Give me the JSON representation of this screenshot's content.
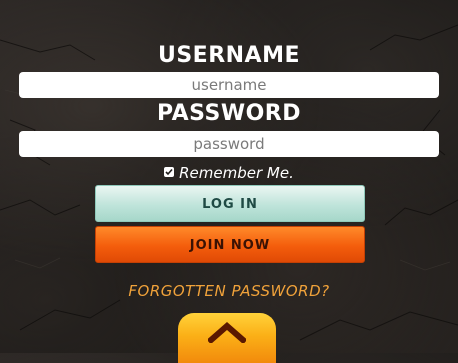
{
  "form": {
    "username_label": "USERNAME",
    "username_placeholder": "username",
    "password_label": "PASSWORD",
    "password_placeholder": "password",
    "remember_label": "Remember Me.",
    "remember_checked": true,
    "login_label": "LOG IN",
    "join_label": "JOIN NOW",
    "forgot_label": "FORGOTTEN PASSWORD?"
  },
  "scroll_top": {
    "icon": "chevron-up-icon"
  },
  "colors": {
    "background": "#1f1c1a",
    "login_button": "#bfe4da",
    "join_button": "#f45d0c",
    "forgot_link": "#f0a23a",
    "scroll_tab": "#fbb017"
  }
}
